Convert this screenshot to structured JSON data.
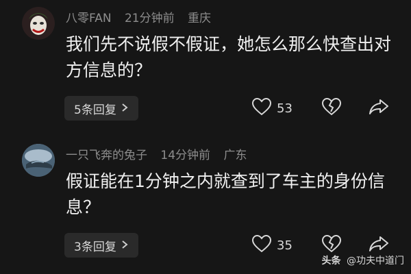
{
  "comments": [
    {
      "username": "八零FAN",
      "time": "21分钟前",
      "location": "重庆",
      "text": "我们先不说假不假证，她怎么那么快查出对方信息的？",
      "replies": "5条回复",
      "likes": "53"
    },
    {
      "username": "一只飞奔的兔子",
      "time": "14分钟前",
      "location": "广东",
      "text": "假证能在1分钟之内就查到了车主的身份信息？",
      "replies": "3条回复",
      "likes": "35"
    }
  ],
  "watermark": {
    "brand": "头条",
    "account": "@功夫中道门"
  },
  "icons": {
    "like": "heart-icon",
    "dislike": "broken-heart-icon",
    "share": "share-arrow-icon",
    "replies_chevron": "chevron-right-icon"
  },
  "colors": {
    "background": "#161616",
    "reply_pill": "#2a2a2a",
    "meta_text": "#8d8d8d",
    "body_text": "#f0f0f0"
  }
}
